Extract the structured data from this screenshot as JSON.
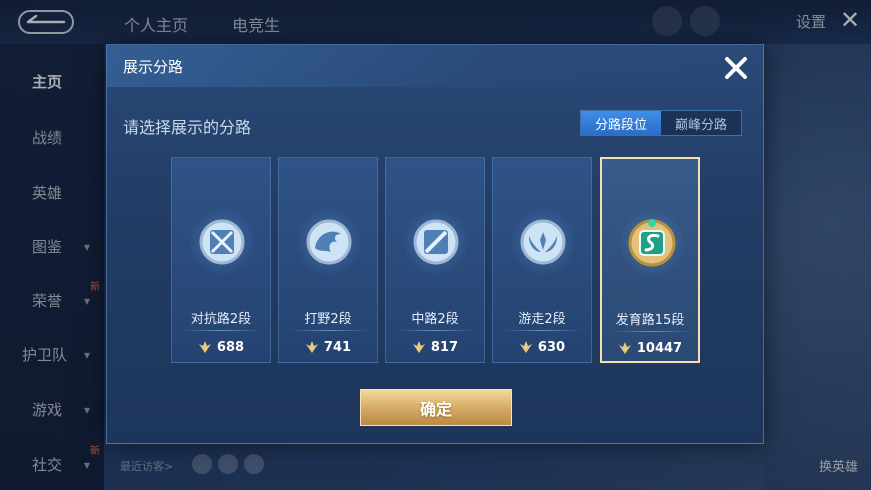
{
  "background": {
    "tabs": [
      "个人主页",
      "电竞生"
    ],
    "settings_label": "设置",
    "sidebar": [
      {
        "label": "主页",
        "active": true,
        "arrow": false,
        "badge": ""
      },
      {
        "label": "战绩",
        "active": false,
        "arrow": false,
        "badge": ""
      },
      {
        "label": "英雄",
        "active": false,
        "arrow": false,
        "badge": ""
      },
      {
        "label": "图鉴",
        "active": false,
        "arrow": true,
        "badge": ""
      },
      {
        "label": "荣誉",
        "active": false,
        "arrow": true,
        "badge": "新"
      },
      {
        "label": "护卫队",
        "active": false,
        "arrow": true,
        "badge": ""
      },
      {
        "label": "游戏",
        "active": false,
        "arrow": true,
        "badge": ""
      },
      {
        "label": "社交",
        "active": false,
        "arrow": true,
        "badge": "新"
      }
    ],
    "recent_visitors_label": "最近访客>",
    "change_hero_label": "换英雄"
  },
  "dialog": {
    "title": "展示分路",
    "prompt": "请选择展示的分路",
    "toggle": [
      {
        "label": "分路段位",
        "active": true
      },
      {
        "label": "巅峰分路",
        "active": false
      }
    ],
    "cards": [
      {
        "label": "对抗路2段",
        "score": "688",
        "icon": "sword-lane-icon",
        "selected": false
      },
      {
        "label": "打野2段",
        "score": "741",
        "icon": "jungle-dragon-icon",
        "selected": false
      },
      {
        "label": "中路2段",
        "score": "817",
        "icon": "mid-lane-icon",
        "selected": false
      },
      {
        "label": "游走2段",
        "score": "630",
        "icon": "roam-wings-icon",
        "selected": false
      },
      {
        "label": "发育路15段",
        "score": "10447",
        "icon": "farm-lane-icon",
        "selected": true
      }
    ],
    "confirm_label": "确定"
  },
  "colors": {
    "accent_blue": "#3f8ee8",
    "gold": "#d9b06a",
    "selected_border": "#f3dfb2"
  }
}
